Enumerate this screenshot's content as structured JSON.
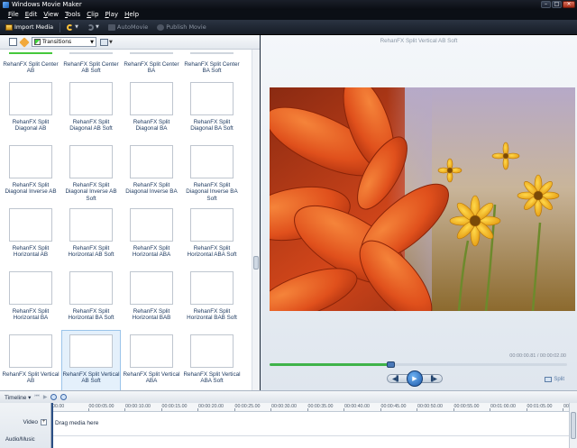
{
  "window": {
    "title": "Windows Movie Maker"
  },
  "menu": [
    {
      "hot": "F",
      "rest": "ile"
    },
    {
      "hot": "E",
      "rest": "dit"
    },
    {
      "hot": "V",
      "rest": "iew"
    },
    {
      "hot": "T",
      "rest": "ools"
    },
    {
      "hot": "C",
      "rest": "lip"
    },
    {
      "hot": "P",
      "rest": "lay"
    },
    {
      "hot": "H",
      "rest": "elp"
    }
  ],
  "toolbar": {
    "import_label": "Import Media",
    "automovie_label": "AutoMovie",
    "publish_label": "Publish Movie"
  },
  "pane": {
    "dropdown_value": "Transitions"
  },
  "row0_captions": [
    "RehanFX Split Center AB",
    "RehanFX Split Center AB Soft",
    "RehanFX Split Center BA",
    "RehanFX Split Center BA Soft"
  ],
  "transitions": [
    {
      "label": "RehanFX Split Diagonal AB",
      "pattern": "diag-ab"
    },
    {
      "label": "RehanFX Split Diagonal AB Soft",
      "pattern": "diag-ab-soft"
    },
    {
      "label": "RehanFX Split Diagonal BA",
      "pattern": "diag-ba"
    },
    {
      "label": "RehanFX Split Diagonal BA Soft",
      "pattern": "diag-ba-soft"
    },
    {
      "label": "RehanFX Split Diagonal Inverse AB",
      "pattern": "dinv-ab"
    },
    {
      "label": "RehanFX Split Diagonal Inverse AB Soft",
      "pattern": "dinv-ab-soft"
    },
    {
      "label": "RehanFX Split Diagonal Inverse BA",
      "pattern": "dinv-ba"
    },
    {
      "label": "RehanFX Split Diagonal Inverse BA Soft",
      "pattern": "dinv-ba-soft"
    },
    {
      "label": "RehanFX Split Horizontal AB",
      "pattern": "hz-ab"
    },
    {
      "label": "RehanFX Split Horizontal AB Soft",
      "pattern": "hz-ab-soft"
    },
    {
      "label": "RehanFX Split Horizontal ABA",
      "pattern": "hz-aba"
    },
    {
      "label": "RehanFX Split Horizontal ABA Soft",
      "pattern": "hz-aba-soft"
    },
    {
      "label": "RehanFX Split Horizontal BA",
      "pattern": "hz-ba"
    },
    {
      "label": "RehanFX Split Horizontal BA Soft",
      "pattern": "hz-ba-soft"
    },
    {
      "label": "RehanFX Split Horizontal BAB",
      "pattern": "hz-bab"
    },
    {
      "label": "RehanFX Split Horizontal BAB Soft",
      "pattern": "hz-bab-soft"
    },
    {
      "label": "RehanFX Split Vertical AB",
      "pattern": "vt-ab"
    },
    {
      "label": "RehanFX Split Vertical AB Soft",
      "pattern": "vt-ab-soft",
      "selected": true
    },
    {
      "label": "RehanFX Split Vertical ABA",
      "pattern": "vt-aba"
    },
    {
      "label": "RehanFX Split Vertical ABA Soft",
      "pattern": "vt-aba-soft"
    }
  ],
  "preview": {
    "title": "RehanFX Split Vertical AB Soft",
    "timecode": "00:00:00.81 / 00:00:02.00",
    "progress_fraction": 0.405,
    "split_label": "Split"
  },
  "timeline": {
    "mode_label": "Timeline",
    "video_track_label": "Video",
    "audio_track_label": "Audio/Music",
    "drag_hint": "Drag media here",
    "ruler_ticks": [
      "00.00",
      "00:00:05.00",
      "00:00:10.00",
      "00:00:15.00",
      "00:00:20.00",
      "00:00:25.00",
      "00:00:30.00",
      "00:00:35.00",
      "00:00:40.00",
      "00:00:45.00",
      "00:00:50.00",
      "00:00:55.00",
      "00:01:00.00",
      "00:01:05.00",
      "00:01:10.00"
    ]
  },
  "colors": {
    "transition_green": "#2ab52a",
    "selection_bg": "#e4f0fb",
    "seek_fill": "#3fb34a",
    "play_button": "#1c58a8"
  }
}
